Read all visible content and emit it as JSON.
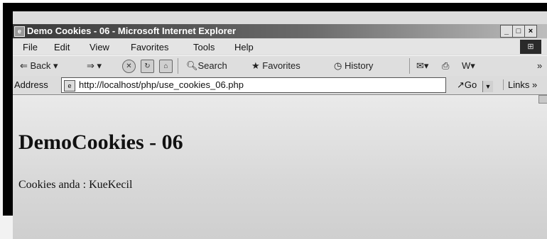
{
  "window": {
    "title": "Demo Cookies - 06 - Microsoft Internet Explorer",
    "controls": {
      "minimize": "_",
      "maximize": "□",
      "close": "×"
    }
  },
  "menu": {
    "items": [
      {
        "label": "File"
      },
      {
        "label": "Edit"
      },
      {
        "label": "View"
      },
      {
        "label": "Favorites"
      },
      {
        "label": "Tools"
      },
      {
        "label": "Help"
      }
    ]
  },
  "toolbar": {
    "back": "Back",
    "search": "Search",
    "favorites": "Favorites",
    "history": "History",
    "overflow": "»"
  },
  "address": {
    "label": "Address",
    "url": "http://localhost/php/use_cookies_06.php",
    "go": "Go",
    "links": "Links",
    "overflow": "»"
  },
  "page": {
    "heading": "DemoCookies - 06",
    "text": "Cookies anda : KueKecil"
  }
}
